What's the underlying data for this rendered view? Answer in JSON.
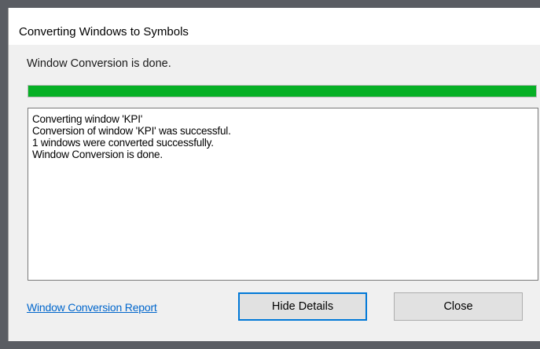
{
  "window": {
    "title": "Converting Windows to Symbols"
  },
  "status": {
    "message": "Window Conversion is done.",
    "progress_percent": 100,
    "progress_color": "#06b025"
  },
  "details": {
    "lines": [
      "Converting window 'KPI'",
      "Conversion of window 'KPI' was successful.",
      "1 windows were converted successfully.",
      "Window Conversion is done."
    ]
  },
  "footer": {
    "report_link_label": "Window Conversion Report",
    "hide_details_label": "Hide Details",
    "close_label": "Close"
  }
}
